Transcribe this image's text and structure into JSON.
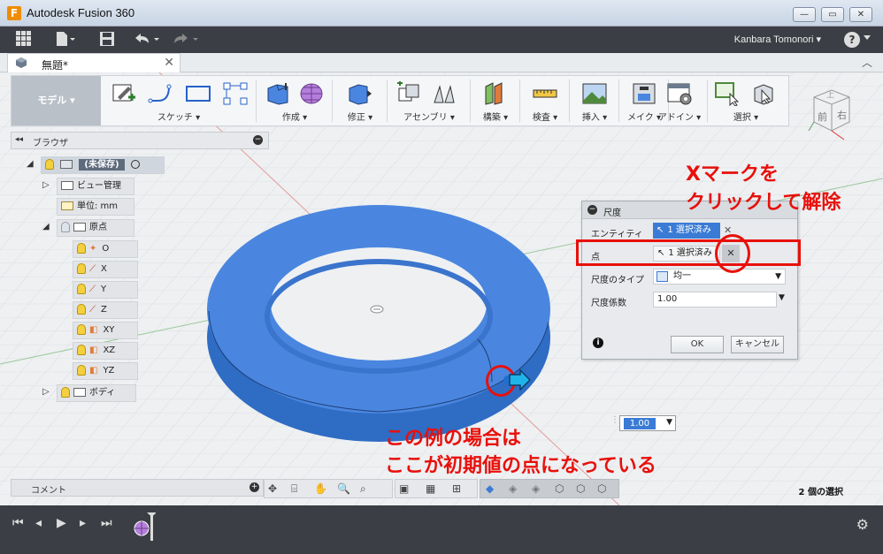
{
  "window": {
    "title": "Autodesk Fusion 360",
    "app_icon": "F",
    "min": "—",
    "max": "▭",
    "close": "✕"
  },
  "appbar": {
    "user_name": "Kanbara Tomonori ▾",
    "help": "?"
  },
  "tab": {
    "label": "無題*",
    "close": "✕"
  },
  "ribbon": {
    "workspace": "モデル ▾",
    "groups": [
      {
        "label": "スケッチ ▾"
      },
      {
        "label": "作成 ▾"
      },
      {
        "label": "修正 ▾"
      },
      {
        "label": "アセンブリ ▾"
      },
      {
        "label": "構築 ▾"
      },
      {
        "label": "検査 ▾"
      },
      {
        "label": "挿入 ▾"
      },
      {
        "label": "メイク ▾"
      },
      {
        "label": "アドイン ▾"
      },
      {
        "label": "選択 ▾"
      }
    ]
  },
  "viewcube": {
    "front": "前",
    "right": "右",
    "top": "上"
  },
  "browser": {
    "title": "ブラウザ",
    "root": "(未保存)",
    "items": [
      {
        "label": "ビュー管理"
      },
      {
        "label": "単位: mm"
      },
      {
        "label": "原点"
      },
      {
        "label": "O"
      },
      {
        "label": "X"
      },
      {
        "label": "Y"
      },
      {
        "label": "Z"
      },
      {
        "label": "XY"
      },
      {
        "label": "XZ"
      },
      {
        "label": "YZ"
      },
      {
        "label": "ボディ"
      }
    ]
  },
  "dialog": {
    "title": "尺度",
    "entity_label": "エンティティ",
    "entity_value": "1 選択済み",
    "point_label": "点",
    "point_value": "1 選択済み",
    "scale_type_label": "尺度のタイプ",
    "scale_type_value": "均一",
    "scale_factor_label": "尺度係数",
    "scale_factor_value": "1.00",
    "ok": "OK",
    "cancel": "キャンセル",
    "clear_x": "✕"
  },
  "canvas_input_value": "1.00",
  "bottom": {
    "comment": "コメント",
    "selection_count": "2 個の選択"
  },
  "annotations": {
    "x_mark_line1": "Xマークを",
    "x_mark_line2": "クリックして解除",
    "example_line1": "この例の場合は",
    "example_line2": "ここが初期値の点になっている"
  },
  "colors": {
    "torus": "#3f7fd8",
    "annotation": "#e8100b",
    "titlebar": "#c7d4e4",
    "dark_bar": "#3b3f45"
  }
}
